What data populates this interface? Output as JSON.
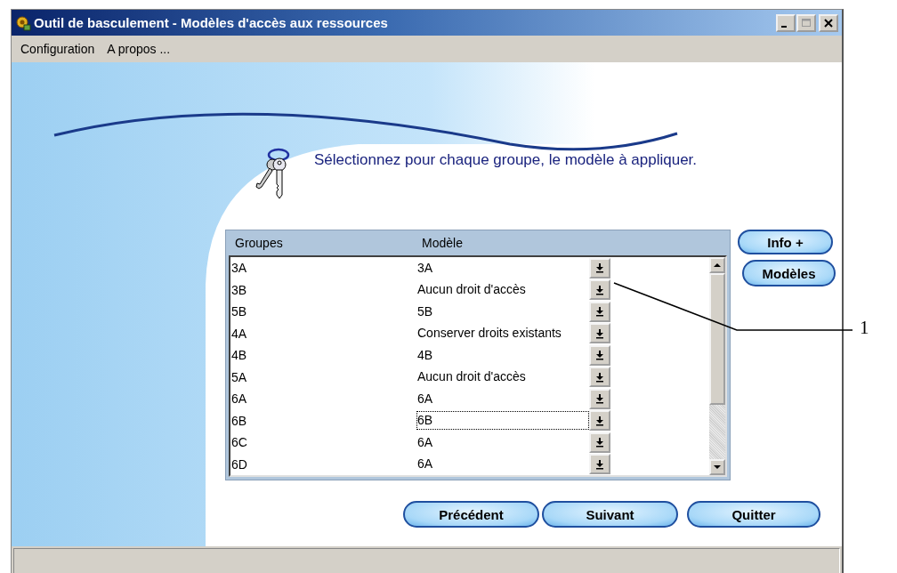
{
  "window": {
    "title": "Outil de basculement - Modèles d'accès aux ressources"
  },
  "menu": [
    "Configuration",
    "A propos ..."
  ],
  "instruction": "Sélectionnez pour chaque groupe, le modèle à appliquer.",
  "table": {
    "columns": [
      "Groupes",
      "Modèle"
    ],
    "rows": [
      {
        "group": "3A",
        "model": "3A",
        "focused": false
      },
      {
        "group": "3B",
        "model": "Aucun droit d'accès",
        "focused": false
      },
      {
        "group": "5B",
        "model": "5B",
        "focused": false
      },
      {
        "group": "4A",
        "model": "Conserver droits existants",
        "focused": false
      },
      {
        "group": "4B",
        "model": "4B",
        "focused": false
      },
      {
        "group": "5A",
        "model": "Aucun droit d'accès",
        "focused": false
      },
      {
        "group": "6A",
        "model": "6A",
        "focused": false
      },
      {
        "group": "6B",
        "model": "6B",
        "focused": true
      },
      {
        "group": "6C",
        "model": "6A",
        "focused": false
      },
      {
        "group": "6D",
        "model": "6A",
        "focused": false
      }
    ]
  },
  "side_buttons": [
    "Info +",
    "Modèles"
  ],
  "nav_buttons": [
    "Précédent",
    "Suivant",
    "Quitter"
  ],
  "callout": {
    "label": "1"
  }
}
